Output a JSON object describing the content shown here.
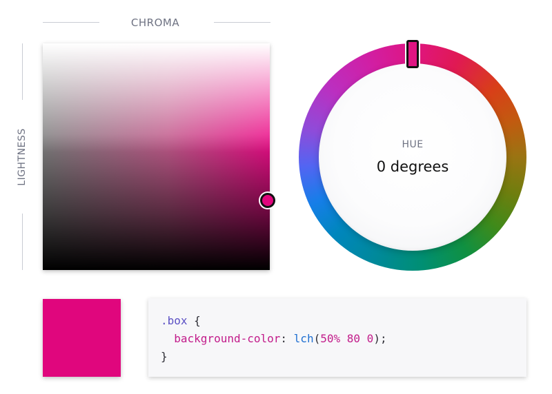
{
  "labels": {
    "chroma": "CHROMA",
    "lightness": "LIGHTNESS",
    "hue": "HUE"
  },
  "hue": {
    "value_text": "0 degrees",
    "degrees": 0
  },
  "color": {
    "css_value": "lch(50% 80 0)",
    "lightness": 50,
    "chroma": 80,
    "hue": 0,
    "swatch_hex": "#e0067d"
  },
  "code": {
    "selector": ".box",
    "open_brace": "{",
    "property": "background-color",
    "colon": ":",
    "function": "lch",
    "paren_open": "(",
    "arg_lightness": "50%",
    "arg_chroma": "80",
    "arg_hue": "0",
    "paren_close": ");",
    "close_brace": "}"
  },
  "colors": {
    "accent": "#e0067d",
    "label_gray": "#6e7282",
    "selector": "#5a4fc4",
    "property": "#c21b8a",
    "function": "#1f6fd1"
  }
}
